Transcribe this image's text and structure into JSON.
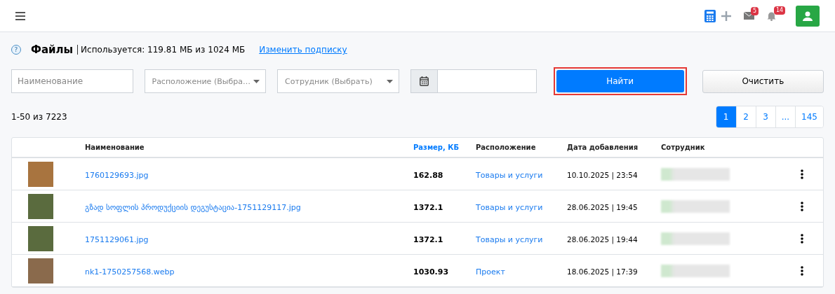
{
  "header": {
    "badges": [
      {
        "kind": "mail",
        "count": "5"
      },
      {
        "kind": "bell",
        "count": "14"
      }
    ]
  },
  "title": {
    "help": "?",
    "heading": "Файлы",
    "usage": "Используется: 119.81 МБ из 1024 МБ",
    "link": "Изменить подписку"
  },
  "filters": {
    "name": {
      "placeholder": "Наименование"
    },
    "location": {
      "placeholder": "Расположение (Выбра…"
    },
    "employee": {
      "placeholder": "Сотрудник (Выбрать)"
    },
    "find": {
      "label": "Найти",
      "focused": true
    },
    "clear": {
      "label": "Очистить"
    }
  },
  "count": "1-50 из 7223",
  "pagination": [
    {
      "label": "1",
      "selected": true
    },
    {
      "label": "2",
      "selected": false
    },
    {
      "label": "3",
      "selected": false
    },
    {
      "label": "...",
      "selected": false
    },
    {
      "label": "145",
      "selected": false
    }
  ],
  "table": {
    "columns": [
      {
        "label": "Наименование",
        "sorted": false
      },
      {
        "label": "Размер, КБ",
        "sorted": true
      },
      {
        "label": "Расположение",
        "sorted": false
      },
      {
        "label": "Дата добавления",
        "sorted": false
      },
      {
        "label": "Сотрудник",
        "sorted": false
      }
    ],
    "rows": [
      {
        "name": "1760129693.jpg",
        "size": "162.88",
        "location": "Товары и услуги",
        "date": "10.10.2025 | 23:54"
      },
      {
        "name": "გზად სოფლის პროდუქციის დეგუსტაცია-1751129117.jpg",
        "size": "1372.1",
        "location": "Товары и услуги",
        "date": "28.06.2025 | 19:45"
      },
      {
        "name": "1751129061.jpg",
        "size": "1372.1",
        "location": "Товары и услуги",
        "date": "28.06.2025 | 19:44"
      },
      {
        "name": "nk1-1750257568.webp",
        "size": "1030.93",
        "location": "Проект",
        "date": "18.06.2025 | 17:39"
      }
    ]
  }
}
